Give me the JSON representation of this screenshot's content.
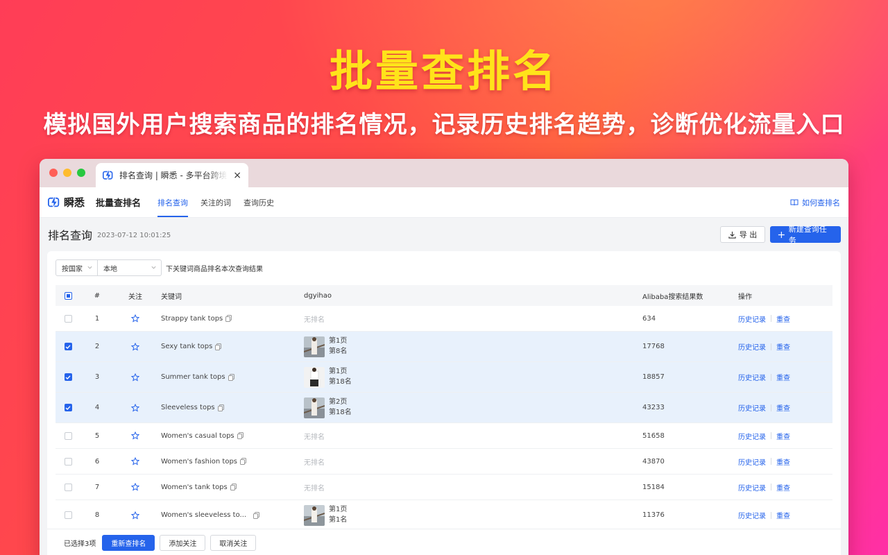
{
  "hero": {
    "title": "批量查排名",
    "subtitle": "模拟国外用户搜索商品的排名情况，记录历史排名趋势，诊断优化流量入口"
  },
  "browser": {
    "tab_title": "排名查询 | 瞬悉 - 多平台跨境",
    "close_glyph": "×"
  },
  "app": {
    "logo_text": "瞬悉",
    "page_name": "批量查排名",
    "nav_tabs": [
      {
        "label": "排名查询",
        "active": true
      },
      {
        "label": "关注的词",
        "active": false
      },
      {
        "label": "查询历史",
        "active": false
      }
    ],
    "howto_label": "如何查排名"
  },
  "toolbar": {
    "title": "排名查询",
    "timestamp": "2023-07-12 10:01:25",
    "export_label": "导 出",
    "new_task_label": "新建查询任务"
  },
  "filters": {
    "country_select": "按国家",
    "region_select": "本地",
    "hint": "下关键词商品排名本次查询结果"
  },
  "table": {
    "headers": {
      "index": "#",
      "follow": "关注",
      "keyword": "关键词",
      "shop": "dgyihao",
      "count": "Alibaba搜索结果数",
      "ops": "操作"
    },
    "rows": [
      {
        "index": "1",
        "keyword": "Strappy tank tops",
        "checked": false,
        "rank": null,
        "no_rank": "无排名",
        "count": "634"
      },
      {
        "index": "2",
        "keyword": "Sexy tank tops",
        "checked": true,
        "rank": {
          "page": "第1页",
          "pos": "第8名"
        },
        "count": "17768"
      },
      {
        "index": "3",
        "keyword": "Summer tank tops",
        "checked": true,
        "rank": {
          "page": "第1页",
          "pos": "第18名"
        },
        "count": "18857"
      },
      {
        "index": "4",
        "keyword": "Sleeveless tops",
        "checked": true,
        "rank": {
          "page": "第2页",
          "pos": "第18名"
        },
        "count": "43233"
      },
      {
        "index": "5",
        "keyword": "Women's casual tops",
        "checked": false,
        "rank": null,
        "no_rank": "无排名",
        "count": "51658"
      },
      {
        "index": "6",
        "keyword": "Women's fashion tops",
        "checked": false,
        "rank": null,
        "no_rank": "无排名",
        "count": "43870"
      },
      {
        "index": "7",
        "keyword": "Women's tank tops",
        "checked": false,
        "rank": null,
        "no_rank": "无排名",
        "count": "15184"
      },
      {
        "index": "8",
        "keyword": "Women's sleeveless to...",
        "checked": false,
        "rank": {
          "page": "第1页",
          "pos": "第1名"
        },
        "count": "11376"
      }
    ],
    "op_history": "历史记录",
    "op_recheck": "重查"
  },
  "footer": {
    "selected_text": "已选择3项",
    "recheck_label": "重新查排名",
    "follow_label": "添加关注",
    "unfollow_label": "取消关注"
  },
  "colors": {
    "accent": "#2563eb",
    "hero_title": "#ffe31a",
    "selected_row": "#e8f1fc"
  }
}
